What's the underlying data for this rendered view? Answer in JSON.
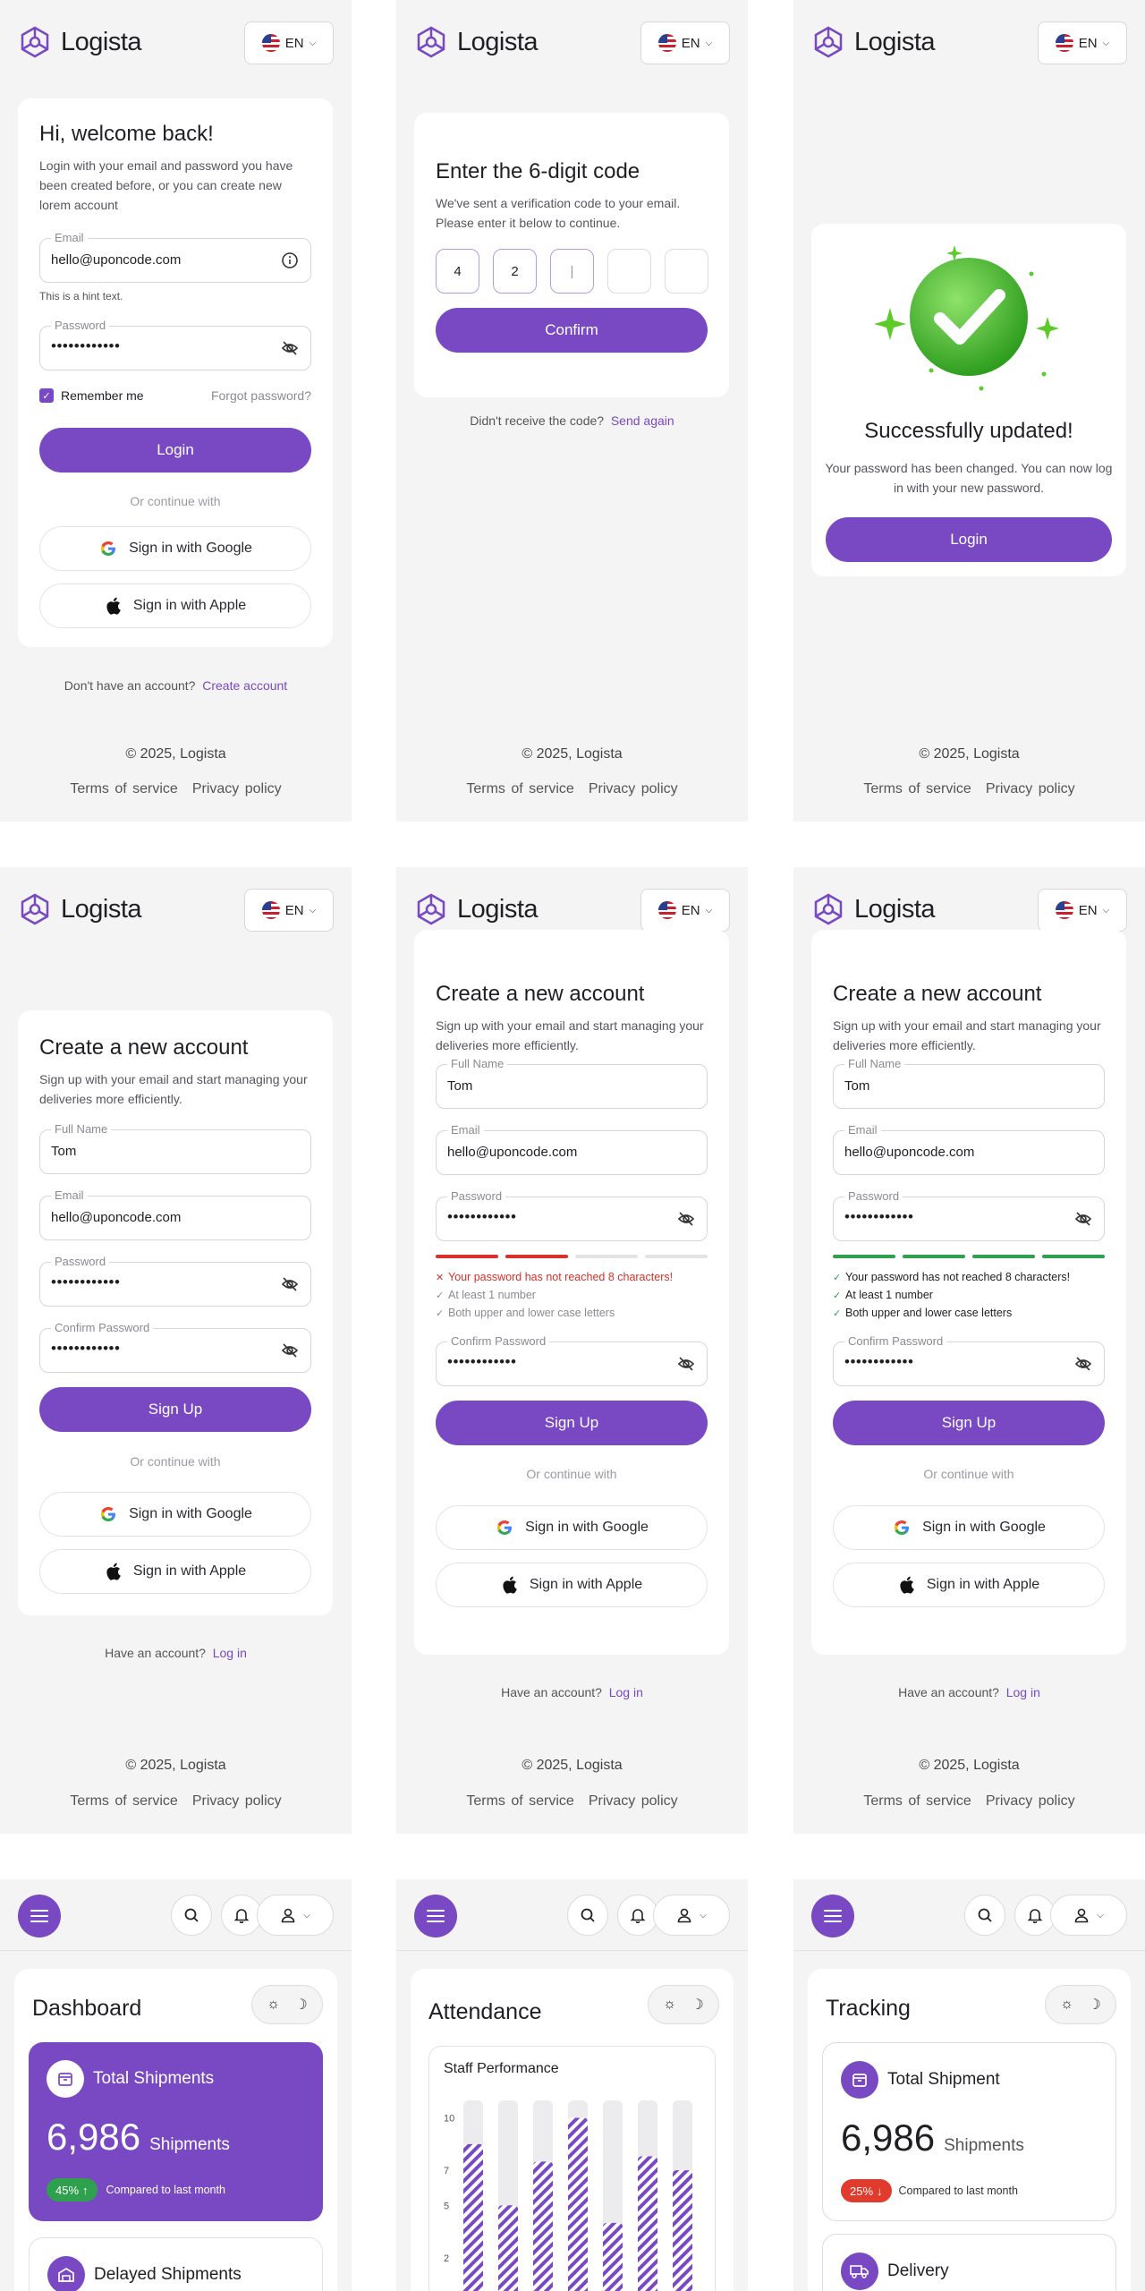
{
  "brand": {
    "name": "Logista",
    "lang": "EN"
  },
  "footer": {
    "copyright": "© 2025, Logista",
    "terms": "Terms of service",
    "privacy": "Privacy policy"
  },
  "login": {
    "title": "Hi, welcome back!",
    "subtitle": "Login with your email and password you have been created before, or you can create new lorem account",
    "email_label": "Email",
    "email_value": "hello@uponcode.com",
    "hint": "This is a hint text.",
    "password_label": "Password",
    "password_value": "••••••••••••",
    "remember": "Remember me",
    "forgot": "Forgot password?",
    "login_btn": "Login",
    "or": "Or continue with",
    "google": "Sign in with Google",
    "apple": "Sign in with Apple",
    "no_account": "Don't have an account?",
    "create": "Create account"
  },
  "verify": {
    "title": "Enter the 6-digit code",
    "subtitle": "We've sent a verification code to your email. Please enter it below to continue.",
    "digits": [
      "4",
      "2",
      "|",
      "",
      ""
    ],
    "confirm": "Confirm",
    "no_code": "Didn't receive the code?",
    "resend": "Send again"
  },
  "success": {
    "title": "Successfully updated!",
    "message": "Your password has been changed. You can now log in with your new password.",
    "login_btn": "Login"
  },
  "signup": {
    "title": "Create a new account",
    "subtitle": "Sign up with your email and start managing your deliveries more efficiently.",
    "name_label": "Full Name",
    "name_value": "Tom",
    "email_label": "Email",
    "email_value": "hello@uponcode.com",
    "password_label": "Password",
    "password_value": "••••••••••••",
    "confirm_label": "Confirm Password",
    "confirm_value": "••••••••••••",
    "signup_btn": "Sign Up",
    "or": "Or continue with",
    "google": "Sign in with Google",
    "apple": "Sign in with Apple",
    "have_account": "Have an account?",
    "login_link": "Log in",
    "rules": [
      "Your password has not reached 8 characters!",
      "At least 1 number",
      "Both upper and lower case letters"
    ]
  },
  "dashboard": {
    "title": "Dashboard",
    "total_label": "Total Shipments",
    "total_value": "6,986",
    "total_unit": "Shipments",
    "total_change": "45%",
    "compare": "Compared to last month",
    "delayed_label": "Delayed Shipments"
  },
  "attendance": {
    "title": "Attendance",
    "chart_title": "Staff Performance",
    "y_ticks": [
      "10",
      "7",
      "5",
      "2"
    ]
  },
  "chart_data": {
    "type": "bar",
    "title": "Staff Performance",
    "categories": [
      "",
      "",
      "",
      "",
      "",
      "",
      ""
    ],
    "series": [
      {
        "values": [
          8.5,
          5,
          7.5,
          10,
          4,
          7.8,
          7
        ]
      }
    ],
    "ylim": [
      0,
      11
    ],
    "y_ticks": [
      10,
      7,
      5,
      2
    ],
    "grid": false,
    "colors": {
      "bar": "#7849c3",
      "track": "#ececef"
    }
  },
  "tracking": {
    "title": "Tracking",
    "total_label": "Total Shipment",
    "total_value": "6,986",
    "total_unit": "Shipments",
    "total_change": "25%",
    "compare": "Compared to last month",
    "delivery_label": "Delivery"
  },
  "colors": {
    "accent": "#7849c3",
    "success": "#2fa04e",
    "error": "#d8302a"
  }
}
